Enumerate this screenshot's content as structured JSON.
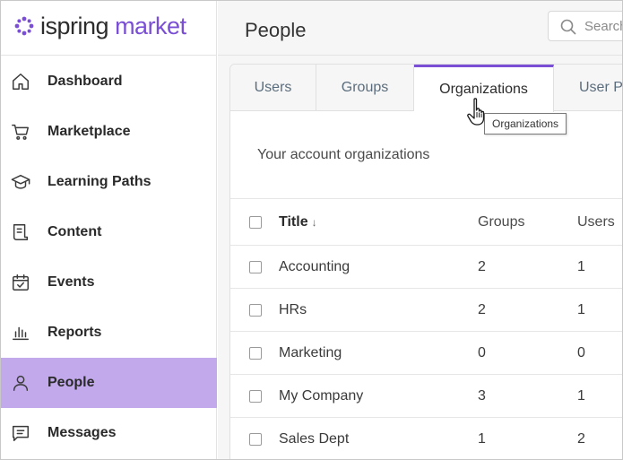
{
  "brand": {
    "name_part1": "ispring",
    "name_part2": "market",
    "accent_color": "#7a4fd6",
    "active_nav_color": "#c2a9ec"
  },
  "sidebar": {
    "items": [
      {
        "label": "Dashboard",
        "icon": "home-icon"
      },
      {
        "label": "Marketplace",
        "icon": "cart-icon"
      },
      {
        "label": "Learning Paths",
        "icon": "graduation-cap-icon"
      },
      {
        "label": "Content",
        "icon": "document-icon"
      },
      {
        "label": "Events",
        "icon": "calendar-check-icon"
      },
      {
        "label": "Reports",
        "icon": "bar-chart-icon"
      },
      {
        "label": "People",
        "icon": "person-icon",
        "active": true
      },
      {
        "label": "Messages",
        "icon": "message-icon"
      }
    ]
  },
  "header": {
    "title": "People",
    "search_placeholder": "Search"
  },
  "tabs": [
    {
      "label": "Users"
    },
    {
      "label": "Groups"
    },
    {
      "label": "Organizations",
      "active": true
    },
    {
      "label": "User Pr"
    }
  ],
  "tooltip": "Organizations",
  "main": {
    "subtitle": "Your account organizations"
  },
  "table": {
    "columns": {
      "title": "Title",
      "groups": "Groups",
      "users": "Users"
    },
    "sort_indicator": "↓",
    "rows": [
      {
        "title": "Accounting",
        "groups": "2",
        "users": "1"
      },
      {
        "title": "HRs",
        "groups": "2",
        "users": "1"
      },
      {
        "title": "Marketing",
        "groups": "0",
        "users": "0"
      },
      {
        "title": "My Company",
        "groups": "3",
        "users": "1"
      },
      {
        "title": "Sales Dept",
        "groups": "1",
        "users": "2"
      }
    ]
  }
}
